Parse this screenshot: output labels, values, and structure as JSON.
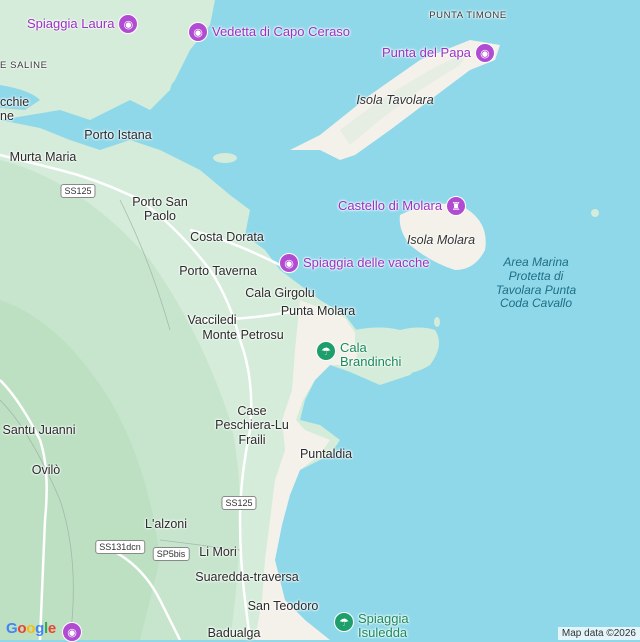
{
  "colors": {
    "sea": "#8fd8ea",
    "land": "#d4ecd9",
    "hills": "#bfe1c6",
    "sand": "#f6f3ec",
    "road": "#ffffff",
    "poi_purple": "#b04bd2",
    "poi_green": "#1e9e6a"
  },
  "places": {
    "punta_timone": "PUNTA TIMONE",
    "saline": "E SALINE",
    "isola_tavolara": "Isola Tavolara",
    "porto_istana": "Porto Istana",
    "murta_maria": "Murta Maria",
    "porto_san_paolo": "Porto San\nPaolo",
    "costa_dorata": "Costa Dorata",
    "porto_taverna": "Porto Taverna",
    "isola_molara": "Isola Molara",
    "cala_girgolu": "Cala Girgolu",
    "punta_molara": "Punta Molara",
    "vacciledi": "Vacciledi",
    "monte_petrosu": "Monte Petrosu",
    "case_peschiera": "Case\nPeschiera-Lu\nFraili",
    "santu_juanni": "Santu Juanni",
    "puntaldia": "Puntaldia",
    "ovilo": "Ovilò",
    "lalzoni": "L'alzoni",
    "li_mori": "Li Mori",
    "suaredda": "Suaredda-traversa",
    "san_teodoro": "San Teodoro",
    "badualga": "Badualga",
    "cut_left": "cchie\nne",
    "area_marina": "Area Marina\nProtetta di\nTavolara Punta\nCoda Cavallo"
  },
  "pois": {
    "spiaggia_laura": "Spiaggia Laura",
    "vedetta": "Vedetta di Capo Ceraso",
    "punta_del_papa": "Punta del Papa",
    "castello_molara": "Castello di Molara",
    "spiaggia_vacche": "Spiaggia delle vacche",
    "cala_brandinchi": "Cala\nBrandinchi",
    "spiaggia_isuledda": "Spiaggia\nIsuledda"
  },
  "roads": {
    "ss125_a": "SS125",
    "ss125_b": "SS125",
    "ss131dcn": "SS131dcn",
    "sp5bis": "SP5bis"
  },
  "icons": {
    "poi_purple": "camera-icon",
    "castle": "castle-icon",
    "beach": "umbrella-icon"
  },
  "attribution": {
    "logo": "Google",
    "map_data": "Map data ©2026"
  }
}
